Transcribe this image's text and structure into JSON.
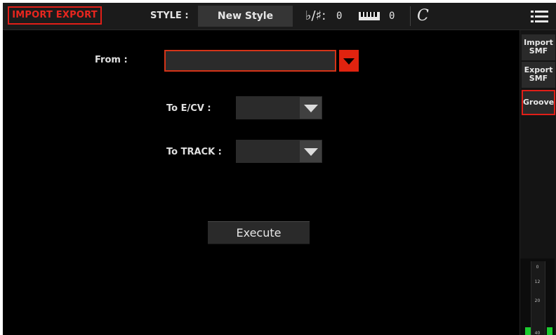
{
  "header": {
    "page_title": "IMPORT EXPORT",
    "style_label": "STYLE :",
    "style_name": "New Style",
    "key_signature_symbol": "♭/♯:",
    "key_signature_value": "0",
    "transpose_value": "0",
    "time_signature_symbol": "C",
    "menu_icon": "hamburger-menu-icon"
  },
  "main": {
    "from_label": "From :",
    "from_value": "",
    "to_ecv_label": "To E/CV :",
    "to_ecv_value": "",
    "to_track_label": "To TRACK :",
    "to_track_value": "",
    "execute_label": "Execute"
  },
  "side_tabs": [
    {
      "line1": "Import",
      "line2": "SMF",
      "active": false
    },
    {
      "line1": "Export",
      "line2": "SMF",
      "active": false
    },
    {
      "line1": "Groove",
      "line2": "",
      "active": true
    }
  ],
  "meter": {
    "ticks": [
      "0",
      "12",
      "20",
      "40"
    ]
  },
  "colors": {
    "accent_red": "#e11e18",
    "meter_green": "#1ccb2f",
    "background": "#000000"
  }
}
